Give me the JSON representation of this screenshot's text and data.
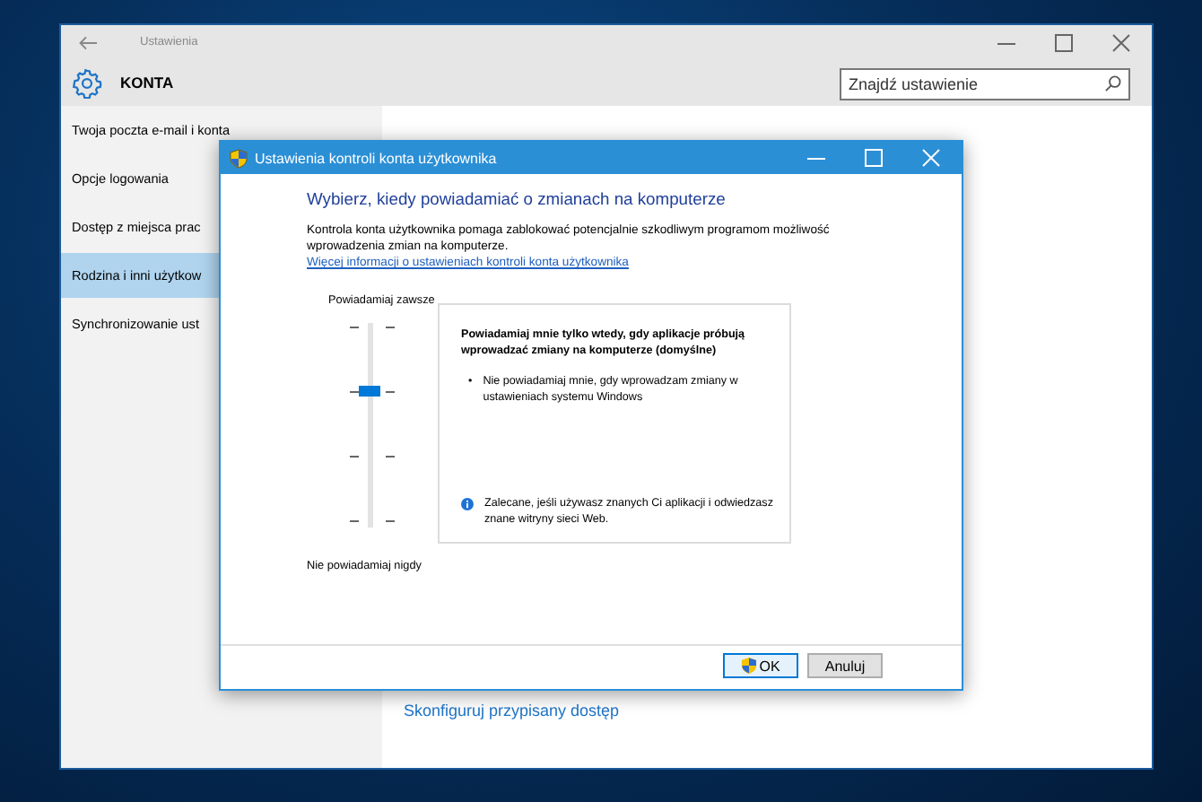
{
  "settings_window": {
    "title": "Ustawienia",
    "section": "KONTA",
    "search": {
      "placeholder": "Znajdź ustawienie"
    },
    "sidebar": {
      "items": [
        {
          "label": "Twoja poczta e-mail i konta",
          "selected": false
        },
        {
          "label": "Opcje logowania",
          "selected": false
        },
        {
          "label": "Dostęp z miejsca prac",
          "selected": false
        },
        {
          "label": "Rodzina i inni użytkow",
          "selected": true
        },
        {
          "label": "Synchronizowanie ust",
          "selected": false
        }
      ]
    },
    "content": {
      "link": "Skonfiguruj przypisany dostęp"
    }
  },
  "dialog": {
    "title": "Ustawienia kontroli konta użytkownika",
    "heading": "Wybierz, kiedy powiadamiać o zmianach na komputerze",
    "description": "Kontrola konta użytkownika pomaga zablokować potencjalnie szkodliwym programom możliwość wprowadzenia zmian na komputerze.",
    "link": "Więcej informacji o ustawieniach kontroli konta użytkownika",
    "slider": {
      "top_label": "Powiadamiaj zawsze",
      "bottom_label": "Nie powiadamiaj nigdy",
      "level": 0.667
    },
    "info": {
      "title": "Powiadamiaj mnie tylko wtedy, gdy aplikacje próbują wprowadzać zmiany na komputerze (domyślne)",
      "bullets": [
        {
          "marker": "•",
          "text": "Nie powiadamiaj mnie, gdy wprowadzam zmiany w ustawieniach systemu Windows"
        }
      ],
      "note": "Zalecane, jeśli używasz znanych Ci aplikacji i odwiedzasz znane witryny sieci Web."
    },
    "buttons": [
      {
        "label": "OK",
        "kind": "shield"
      },
      {
        "label": "Anuluj",
        "kind": "plain"
      }
    ]
  }
}
